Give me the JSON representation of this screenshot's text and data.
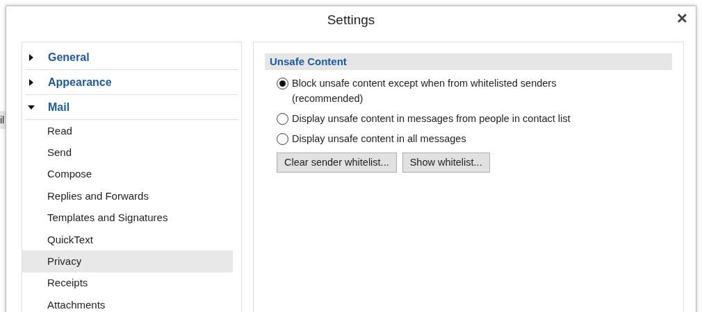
{
  "background_window": {
    "side_text": "il"
  },
  "dialog": {
    "title": "Settings",
    "close": "×"
  },
  "sidebar": {
    "groups": [
      {
        "label": "General",
        "expanded": false
      },
      {
        "label": "Appearance",
        "expanded": false
      },
      {
        "label": "Mail",
        "expanded": true,
        "children": [
          {
            "label": "Read",
            "selected": false
          },
          {
            "label": "Send",
            "selected": false
          },
          {
            "label": "Compose",
            "selected": false
          },
          {
            "label": "Replies and Forwards",
            "selected": false
          },
          {
            "label": "Templates and Signatures",
            "selected": false
          },
          {
            "label": "QuickText",
            "selected": false
          },
          {
            "label": "Privacy",
            "selected": true
          },
          {
            "label": "Receipts",
            "selected": false
          },
          {
            "label": "Attachments",
            "selected": false
          }
        ]
      }
    ]
  },
  "section": {
    "title": "Unsafe Content",
    "options": [
      {
        "label": "Block unsafe content except when from whitelisted senders (recommended)",
        "selected": true
      },
      {
        "label": "Display unsafe content in messages from people in contact list",
        "selected": false
      },
      {
        "label": "Display unsafe content in all messages",
        "selected": false
      }
    ],
    "buttons": [
      "Clear sender whitelist...",
      "Show whitelist..."
    ]
  }
}
